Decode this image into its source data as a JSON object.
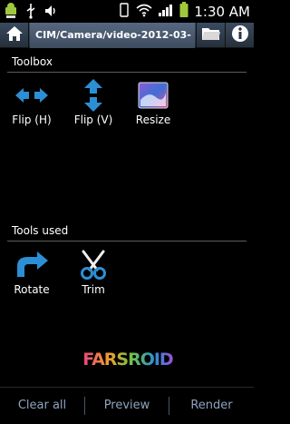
{
  "status_bar": {
    "time": "1:30 AM",
    "left_icons": [
      "android-debug-icon",
      "usb-icon",
      "volume-icon"
    ],
    "right_icons": [
      "vibrate-icon",
      "wifi-icon",
      "signal-icon",
      "battery-icon"
    ]
  },
  "title_bar": {
    "path": "CIM/Camera/video-2012-03-",
    "home_icon": "home-icon",
    "folder_icon": "folder-icon",
    "info_icon": "info-icon"
  },
  "toolbox": {
    "heading": "Toolbox",
    "tools": [
      {
        "label": "Flip (H)",
        "icon": "flip-horizontal-icon"
      },
      {
        "label": "Flip (V)",
        "icon": "flip-vertical-icon"
      },
      {
        "label": "Resize",
        "icon": "resize-icon"
      }
    ]
  },
  "tools_used": {
    "heading": "Tools used",
    "tools": [
      {
        "label": "Rotate",
        "icon": "rotate-icon"
      },
      {
        "label": "Trim",
        "icon": "scissors-icon"
      }
    ]
  },
  "logo": {
    "text": "FARSROID"
  },
  "bottom_bar": {
    "clear_all": "Clear all",
    "preview": "Preview",
    "render": "Render"
  },
  "colors": {
    "accent_blue": "#2b8fd6",
    "bottom_text": "#8fa3bf",
    "title_bar": "#3a4a5e"
  }
}
